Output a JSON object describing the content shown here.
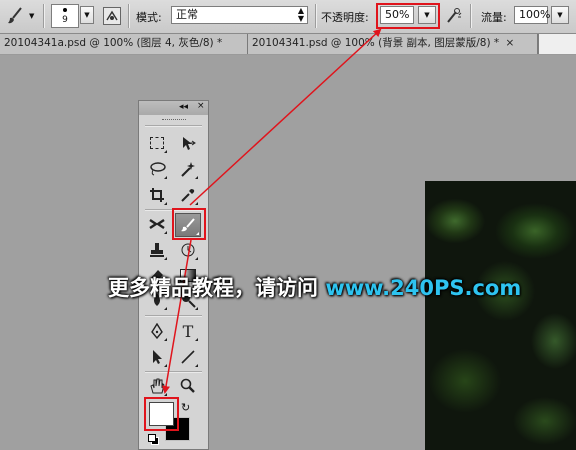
{
  "options_bar": {
    "brush_size": "9",
    "mode_label": "模式:",
    "mode_value": "正常",
    "opacity_label": "不透明度:",
    "opacity_value": "50%",
    "flow_label": "流量:",
    "flow_value": "100%"
  },
  "tabs": [
    {
      "label": "20104341a.psd @ 100% (图层 4, 灰色/8) *",
      "close": "×",
      "active": false
    },
    {
      "label": "20104341.psd @ 100% (背景 副本, 图层蒙版/8) *",
      "close": "×",
      "active": false
    }
  ],
  "tool_panel": {
    "collapse_label": "◂◂",
    "close_label": "×"
  },
  "swatches": {
    "foreground": "#ffffff",
    "background": "#000000"
  },
  "watermark": {
    "text": "更多精品教程，请访问",
    "url": "www.240PS.com"
  },
  "colors": {
    "highlight_red": "#e0141c",
    "url_blue": "#2ec4f0"
  },
  "icons": [
    "brush-icon",
    "brush-preset-icon",
    "airbrush-icon",
    "marquee-icon",
    "move-icon",
    "lasso-icon",
    "magic-wand-icon",
    "crop-icon",
    "eyedropper-icon",
    "healing-icon",
    "brush-tool-icon",
    "stamp-icon",
    "history-brush-icon",
    "eraser-icon",
    "gradient-icon",
    "blur-icon",
    "dodge-icon",
    "pen-icon",
    "type-icon",
    "path-select-icon",
    "line-icon",
    "hand-icon",
    "zoom-icon",
    "swap-colors-icon",
    "default-colors-icon"
  ]
}
